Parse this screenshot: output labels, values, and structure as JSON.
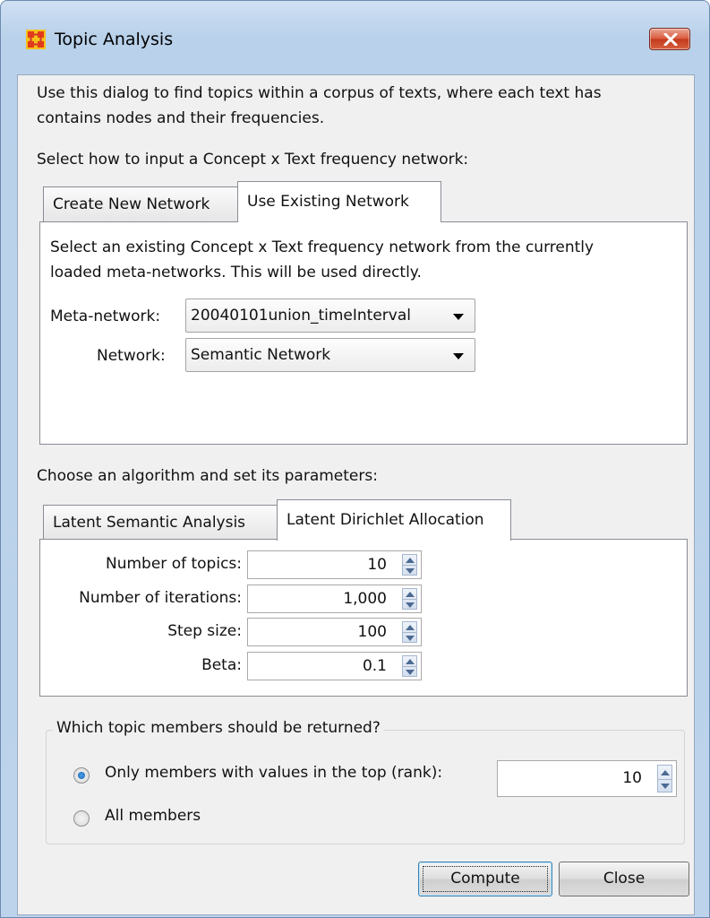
{
  "window": {
    "title": "Topic Analysis"
  },
  "intro": {
    "line1": "Use this dialog to find topics within a corpus of texts, where each text has",
    "line2": "contains nodes and their frequencies."
  },
  "input_section": {
    "heading": "Select how to input a Concept x Text frequency network:",
    "tabs": [
      {
        "label": "Create New Network",
        "active": false
      },
      {
        "label": "Use Existing Network",
        "active": true
      }
    ],
    "panel": {
      "desc_line1": "Select an existing Concept x Text frequency network from the currently",
      "desc_line2": "loaded meta-networks. This will be used directly.",
      "meta_network_label": "Meta-network:",
      "meta_network_value": "20040101union_timeInterval",
      "network_label": "Network:",
      "network_value": "Semantic Network"
    }
  },
  "algorithm_section": {
    "heading": "Choose an algorithm and set its parameters:",
    "tabs": [
      {
        "label": "Latent Semantic Analysis",
        "active": false
      },
      {
        "label": "Latent Dirichlet Allocation",
        "active": true
      }
    ],
    "params": [
      {
        "label": "Number of topics:",
        "value": "10"
      },
      {
        "label": "Number of iterations:",
        "value": "1,000"
      },
      {
        "label": "Step size:",
        "value": "100"
      },
      {
        "label": "Beta:",
        "value": "0.1"
      }
    ]
  },
  "members_section": {
    "legend": "Which topic members should be returned?",
    "option_top": "Only members with values in the top (rank):",
    "option_top_selected": true,
    "top_value": "10",
    "option_all": "All members",
    "option_all_selected": false
  },
  "buttons": {
    "compute": "Compute",
    "close": "Close"
  },
  "colors": {
    "title_bar": "#c4d8ee",
    "close_button": "#d24a2c",
    "radio_selected": "#2a73c2"
  }
}
